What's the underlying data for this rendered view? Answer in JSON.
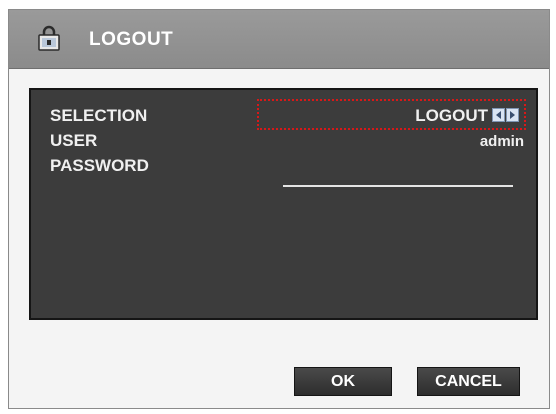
{
  "dialog": {
    "title": "LOGOUT",
    "icon": "lock-icon"
  },
  "form": {
    "selection": {
      "label": "SELECTION",
      "value": "LOGOUT",
      "prev_icon": "arrow-left-icon",
      "next_icon": "arrow-right-icon"
    },
    "user": {
      "label": "USER",
      "value": "admin"
    },
    "password": {
      "label": "PASSWORD",
      "value": ""
    }
  },
  "buttons": {
    "ok_label": "OK",
    "cancel_label": "CANCEL"
  },
  "colors": {
    "titlebar": "#8b8b8b",
    "panel": "#3c3c3c",
    "focus_outline": "#d81818",
    "arrow_button": "#d9e4f3"
  }
}
